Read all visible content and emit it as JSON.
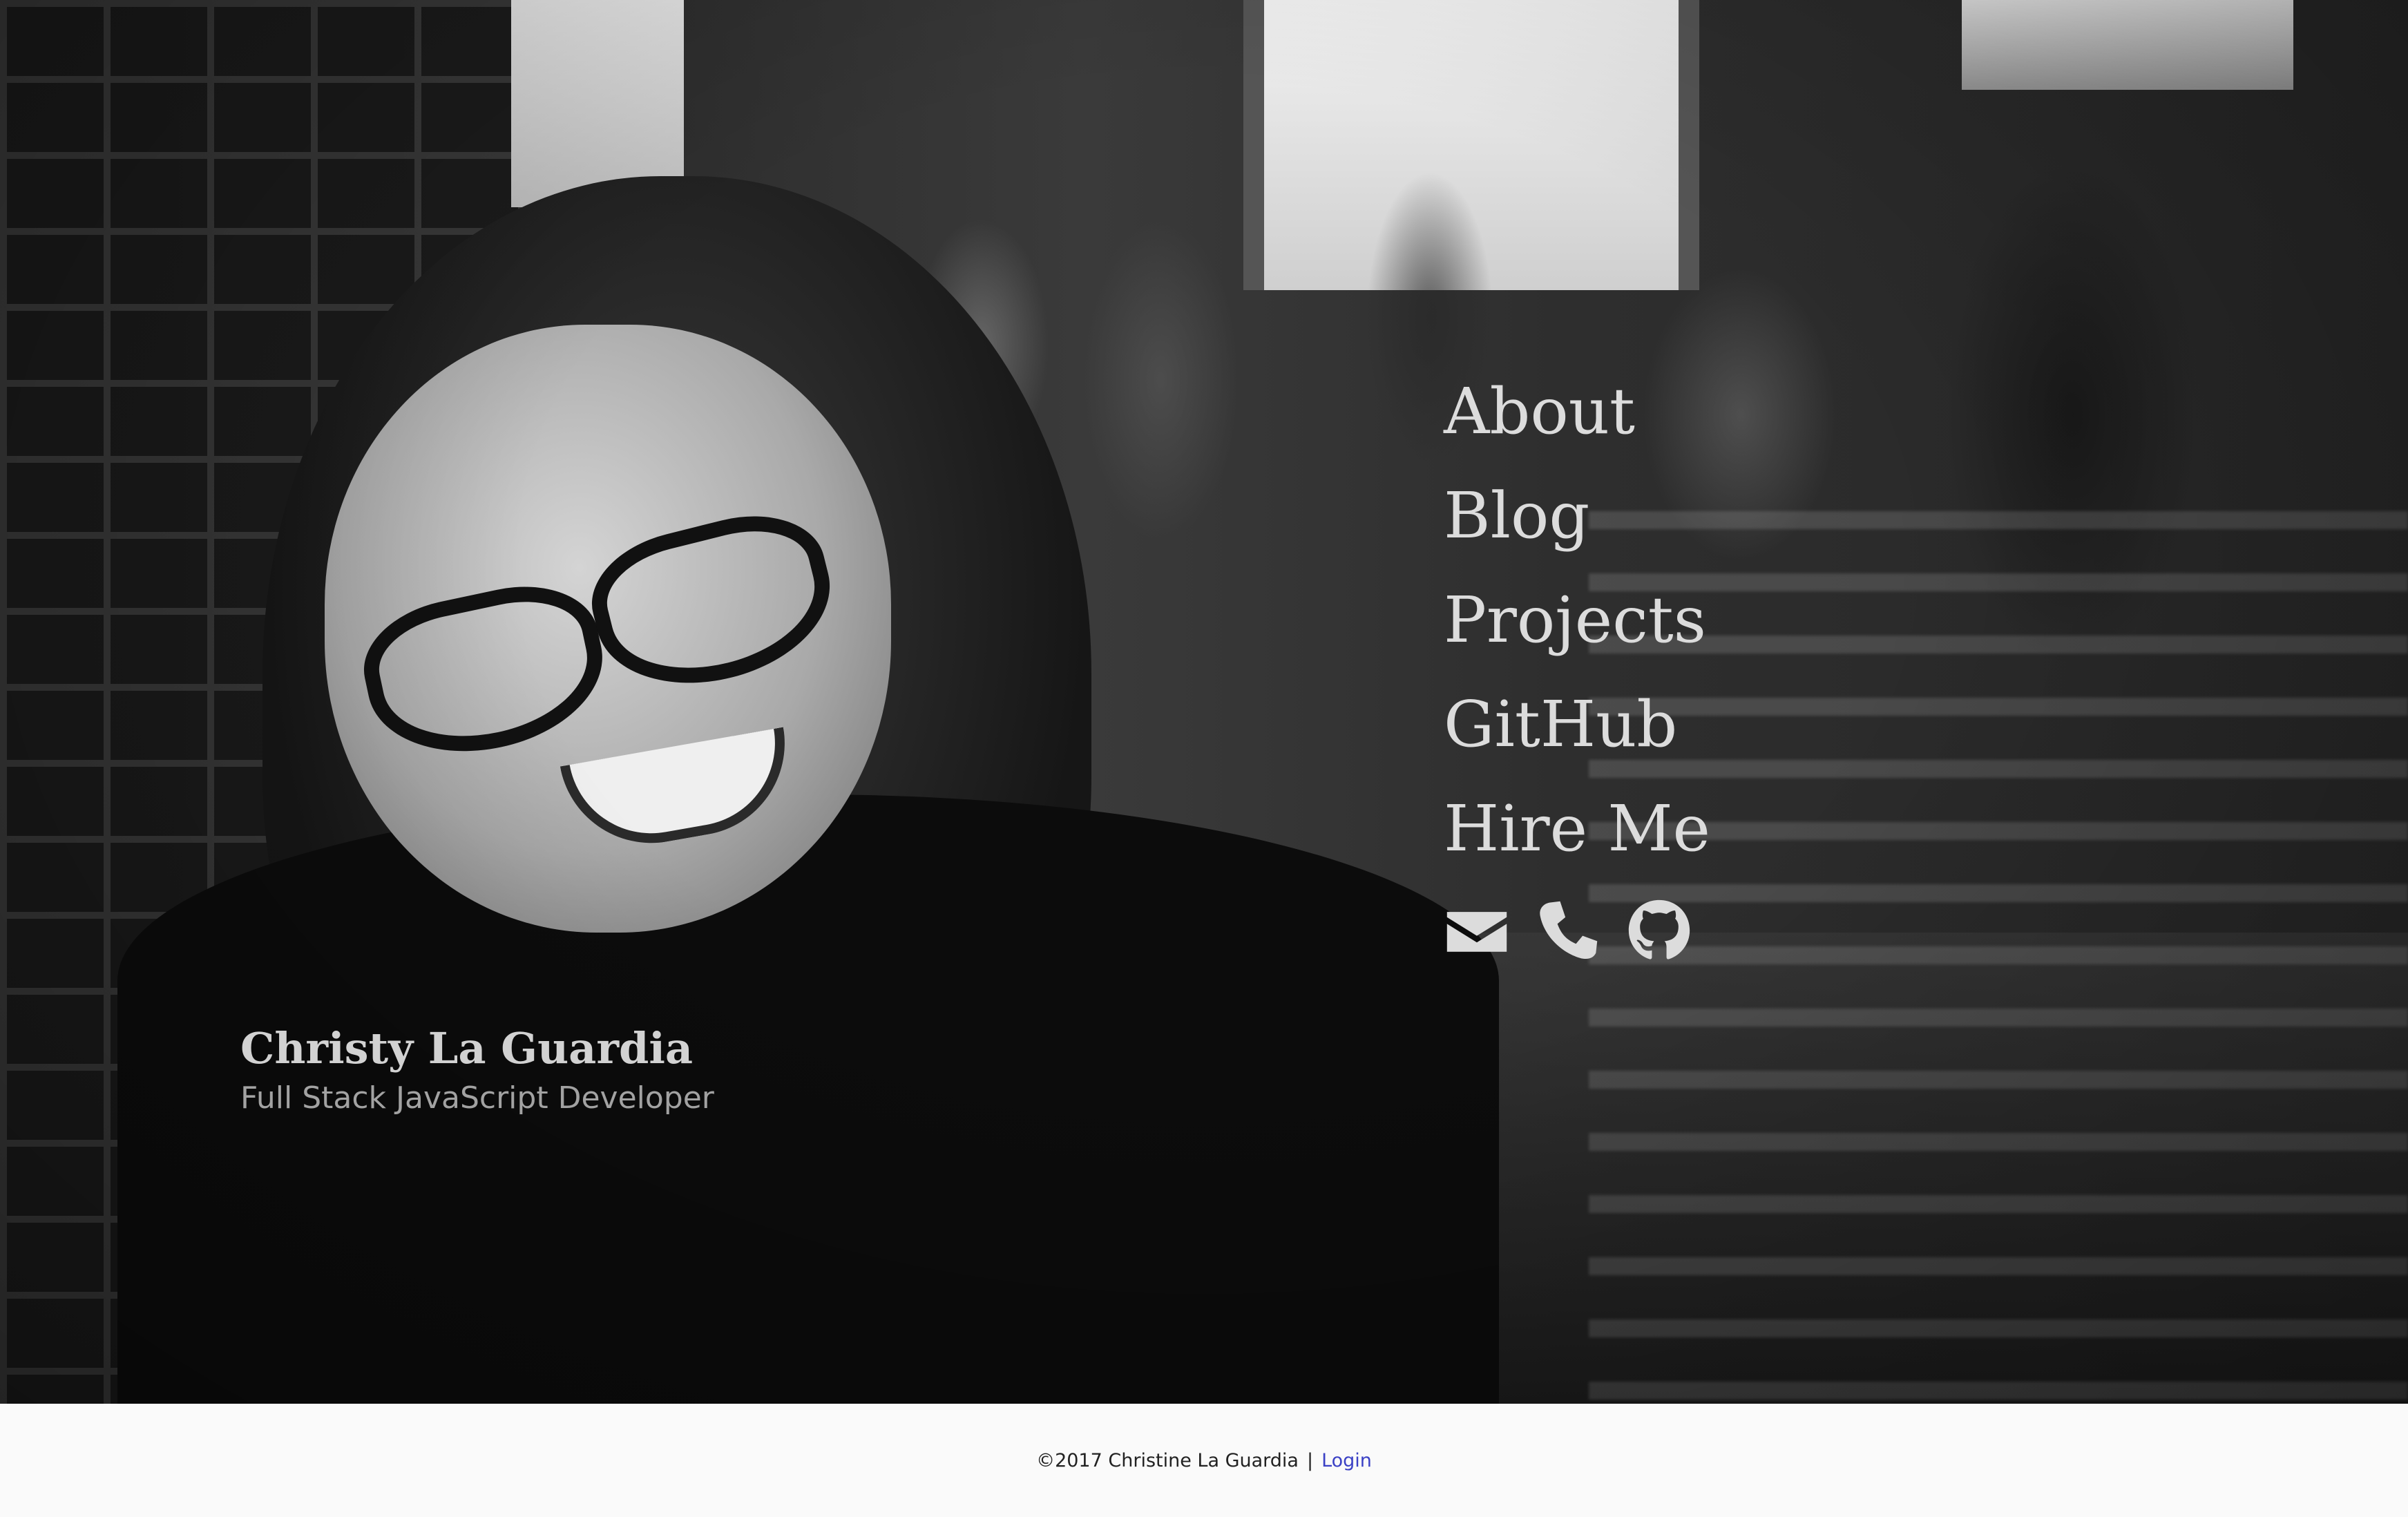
{
  "profile": {
    "name": "Christy La Guardia",
    "tagline": "Full Stack JavaScript Developer"
  },
  "nav": {
    "items": [
      {
        "label": "About"
      },
      {
        "label": "Blog"
      },
      {
        "label": "Projects"
      },
      {
        "label": "GitHub"
      },
      {
        "label": "Hire Me"
      }
    ],
    "icons": [
      "envelope-icon",
      "phone-icon",
      "github-icon"
    ]
  },
  "footer": {
    "copyright": "©2017 Christine La Guardia",
    "separator": "|",
    "login_label": "Login"
  },
  "colors": {
    "nav_text": "#dcdcdc",
    "footer_bg": "#fafafa",
    "login_link": "#3b41c5"
  }
}
